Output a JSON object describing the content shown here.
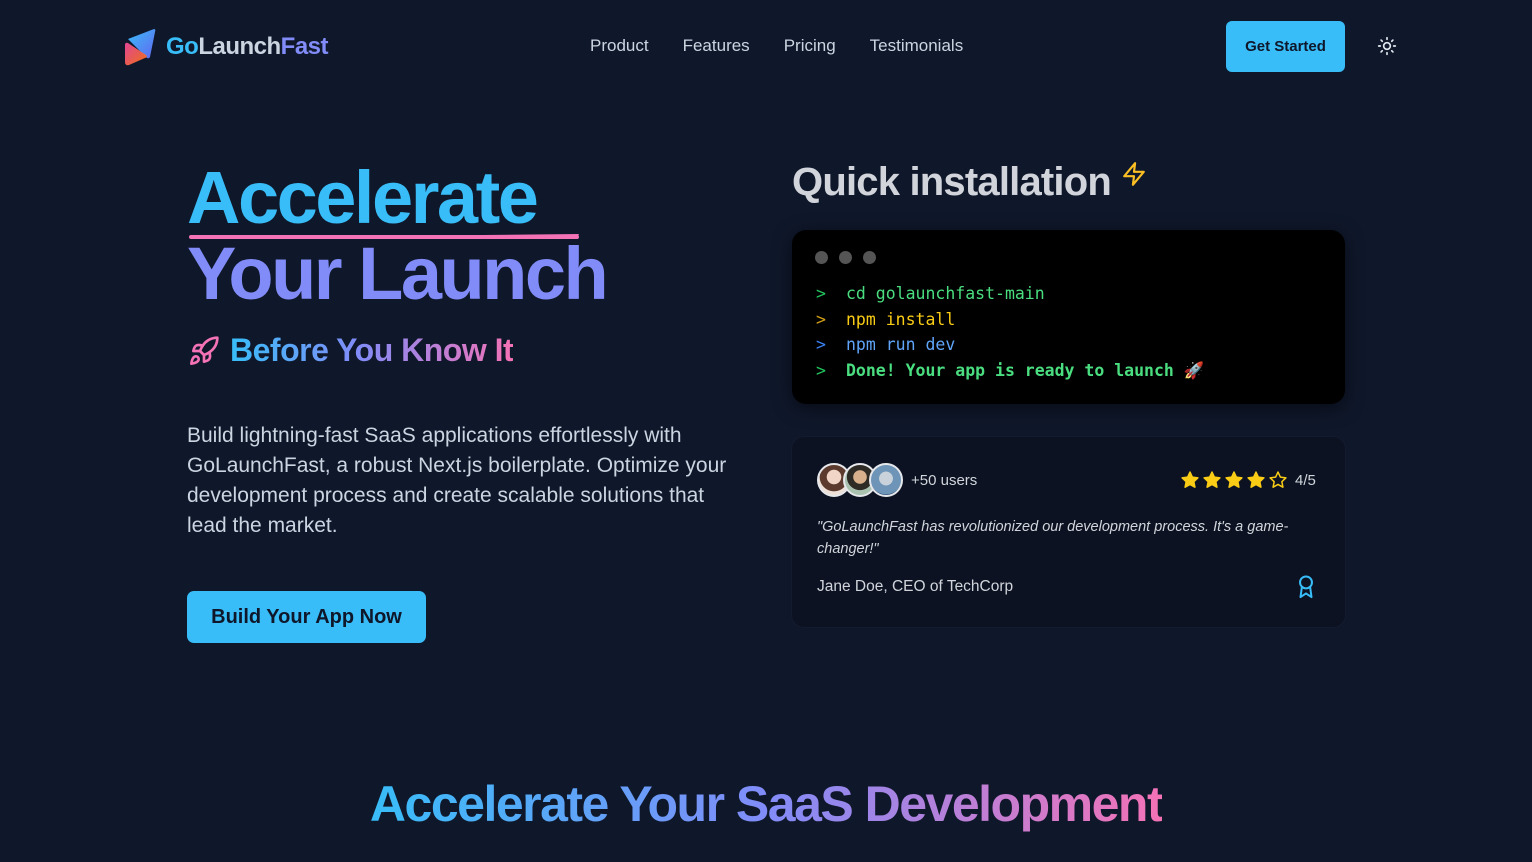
{
  "nav": {
    "brand": {
      "part1": "Go",
      "part2": "Launch",
      "part3": "Fast"
    },
    "links": [
      {
        "label": "Product"
      },
      {
        "label": "Features"
      },
      {
        "label": "Pricing"
      },
      {
        "label": "Testimonials"
      }
    ],
    "cta_label": "Get Started",
    "theme_icon": "sun-icon"
  },
  "hero": {
    "title_line1": "Accelerate",
    "title_line2": "Your Launch",
    "tagline": "Before You Know It",
    "tagline_icon": "rocket-icon",
    "description": "Build lightning-fast SaaS applications effortlessly with GoLaunchFast, a robust Next.js boilerplate. Optimize your development process and create scalable solutions that lead the market.",
    "cta_label": "Build Your App Now"
  },
  "install": {
    "title": "Quick installation",
    "title_icon": "lightning-icon",
    "prompt": ">",
    "lines": [
      {
        "text": "cd golaunchfast-main"
      },
      {
        "text": "npm install"
      },
      {
        "text": "npm run dev"
      },
      {
        "text": "Done! Your app is ready to launch 🚀"
      }
    ]
  },
  "testimonial": {
    "users_count": "+50 users",
    "rating": {
      "value": 4,
      "max": 5,
      "label": "4/5"
    },
    "quote": "\"GoLaunchFast has revolutionized our development process. It's a game-changer!\"",
    "author": "Jane Doe, CEO of TechCorp",
    "badge_icon": "award-icon"
  },
  "section": {
    "heading": "Accelerate Your SaaS Development"
  },
  "colors": {
    "background": "#0f172a",
    "primary": "#38bdf8",
    "secondary": "#818cf8",
    "accent": "#f472b6",
    "star": "#facc15"
  }
}
